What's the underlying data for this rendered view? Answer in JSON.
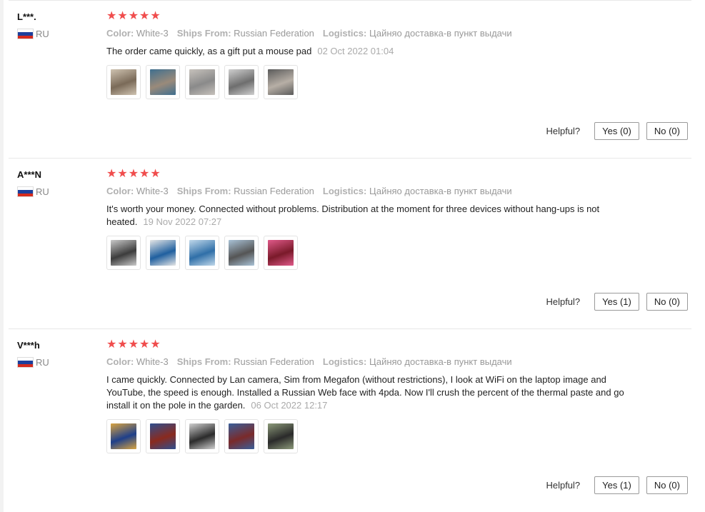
{
  "colors": {
    "star": "#f04d4d",
    "divider": "#e8e8e8",
    "flag_white": "#ffffff",
    "flag_blue": "#1c3f9c",
    "flag_red": "#d52b1e"
  },
  "labels": {
    "color_key": "Color:",
    "ships_key": "Ships From:",
    "logistics_key": "Logistics:",
    "helpful": "Helpful?"
  },
  "reviews": [
    {
      "user": "L***.",
      "country": "RU",
      "rating": 5,
      "color": "White-3",
      "ships_from": "Russian Federation",
      "logistics": "Цайняо доставка-в пункт выдачи",
      "text": "The order came quickly, as a gift put a mouse pad",
      "date": "02 Oct 2022 01:04",
      "photos": [
        {
          "icon": "photo-router-box-thumbnail",
          "colors": [
            "#7a6a58",
            "#cfc3b1"
          ]
        },
        {
          "icon": "photo-mouse-pad-thumbnail",
          "colors": [
            "#9a8a7a",
            "#3f6f8f"
          ]
        },
        {
          "icon": "photo-router-thumbnail",
          "colors": [
            "#8a8a8a",
            "#c7c2bc"
          ]
        },
        {
          "icon": "photo-router-packaging-thumbnail",
          "colors": [
            "#6e6e6e",
            "#cfcfcf"
          ]
        },
        {
          "icon": "photo-router-wall-thumbnail",
          "colors": [
            "#b7afa6",
            "#5a5a5a"
          ]
        }
      ],
      "yes": "Yes (0)",
      "no": "No (0)"
    },
    {
      "user": "A***N",
      "country": "RU",
      "rating": 5,
      "color": "White-3",
      "ships_from": "Russian Federation",
      "logistics": "Цайняо доставка-в пункт выдачи",
      "text": "It's worth your money. Connected without problems. Distribution at the moment for three devices without hang-ups is not heated.",
      "date": "19 Nov 2022 07:27",
      "photos": [
        {
          "icon": "photo-router-mounted-thumbnail",
          "colors": [
            "#3c3c3c",
            "#c9c9c9"
          ]
        },
        {
          "icon": "photo-router-box-blue-thumbnail",
          "colors": [
            "#1f5f9f",
            "#e6e6e6"
          ]
        },
        {
          "icon": "photo-router-blue-box-thumbnail",
          "colors": [
            "#2f6fa8",
            "#c0d8ea"
          ]
        },
        {
          "icon": "photo-router-hand-thumbnail",
          "colors": [
            "#555555",
            "#a9c2d6"
          ]
        },
        {
          "icon": "photo-screen-thumbnail",
          "colors": [
            "#7a1a2a",
            "#e05a8a"
          ]
        }
      ],
      "yes": "Yes (1)",
      "no": "No (0)"
    },
    {
      "user": "V***h",
      "country": "RU",
      "rating": 5,
      "color": "White-3",
      "ships_from": "Russian Federation",
      "logistics": "Цайняо доставка-в пункт выдачи",
      "text": "I came quickly. Connected by Lan camera, Sim from Megafon (without restrictions), I look at WiFi on the laptop image and YouTube, the speed is enough. Installed a Russian Web face with 4pda. Now I'll crush the percent of the thermal paste and go install it on the pole in the garden.",
      "date": "06 Oct 2022 12:17",
      "photos": [
        {
          "icon": "photo-box-blue-thumbnail",
          "colors": [
            "#1e3f8a",
            "#d9a441"
          ]
        },
        {
          "icon": "photo-box-red-thumbnail",
          "colors": [
            "#8a2a1e",
            "#2f4f8f"
          ]
        },
        {
          "icon": "photo-router-table-thumbnail",
          "colors": [
            "#2b2b2b",
            "#d0d0d0"
          ]
        },
        {
          "icon": "photo-box-front-thumbnail",
          "colors": [
            "#7a2a2a",
            "#3a5f9a"
          ]
        },
        {
          "icon": "photo-pole-thumbnail",
          "colors": [
            "#2a2a2a",
            "#8c9a7a"
          ]
        }
      ],
      "yes": "Yes (1)",
      "no": "No (0)"
    }
  ]
}
